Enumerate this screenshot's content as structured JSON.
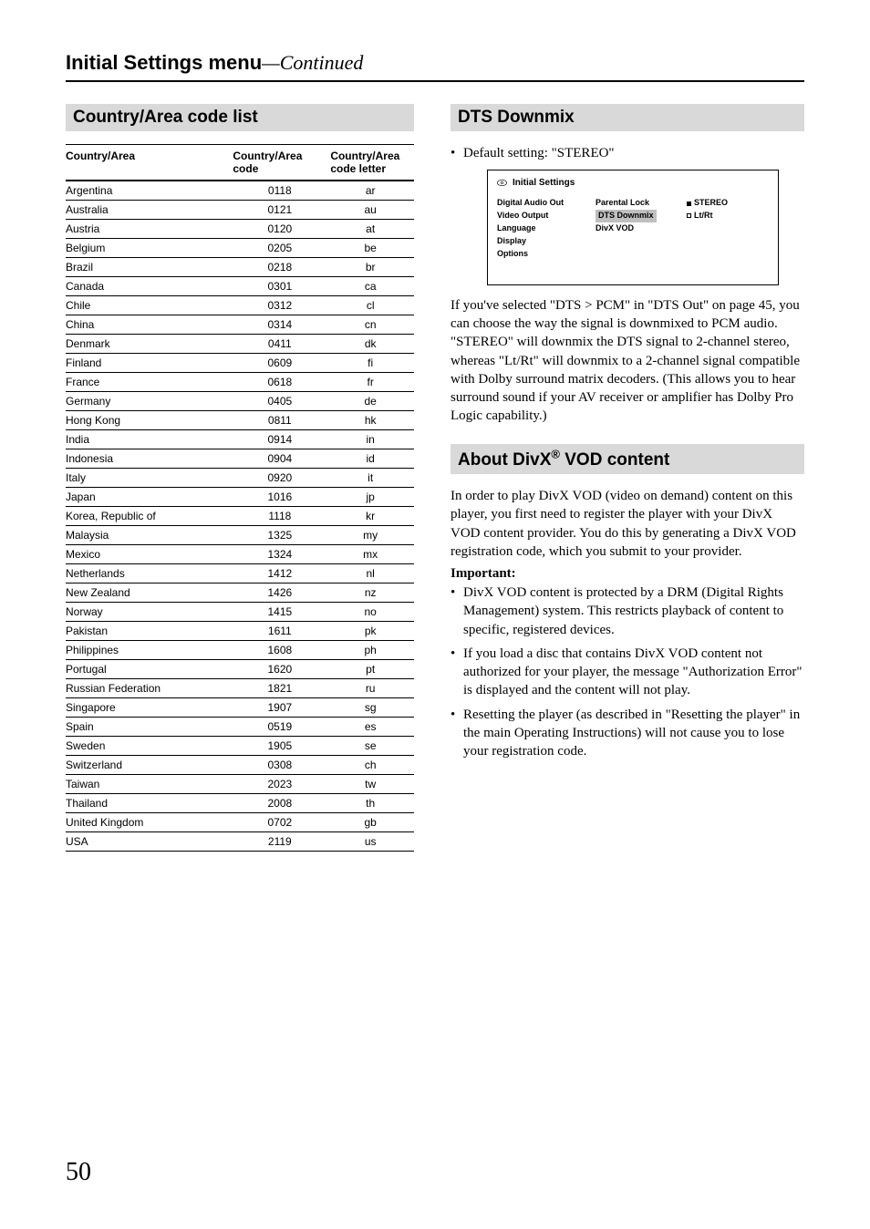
{
  "header": {
    "title": "Initial Settings menu",
    "continued": "—Continued"
  },
  "leftSection": {
    "title": "Country/Area code list",
    "tableHeaders": {
      "col1": "Country/Area",
      "col2": "Country/Area code",
      "col3": "Country/Area code letter"
    },
    "rows": [
      {
        "name": "Argentina",
        "code": "0118",
        "letter": "ar"
      },
      {
        "name": "Australia",
        "code": "0121",
        "letter": "au"
      },
      {
        "name": "Austria",
        "code": "0120",
        "letter": "at"
      },
      {
        "name": "Belgium",
        "code": "0205",
        "letter": "be"
      },
      {
        "name": "Brazil",
        "code": "0218",
        "letter": "br"
      },
      {
        "name": "Canada",
        "code": "0301",
        "letter": "ca"
      },
      {
        "name": "Chile",
        "code": "0312",
        "letter": "cl"
      },
      {
        "name": "China",
        "code": "0314",
        "letter": "cn"
      },
      {
        "name": "Denmark",
        "code": "0411",
        "letter": "dk"
      },
      {
        "name": "Finland",
        "code": "0609",
        "letter": "fi"
      },
      {
        "name": "France",
        "code": "0618",
        "letter": "fr"
      },
      {
        "name": "Germany",
        "code": "0405",
        "letter": "de"
      },
      {
        "name": "Hong Kong",
        "code": "0811",
        "letter": "hk"
      },
      {
        "name": "India",
        "code": "0914",
        "letter": "in"
      },
      {
        "name": "Indonesia",
        "code": "0904",
        "letter": "id"
      },
      {
        "name": "Italy",
        "code": "0920",
        "letter": "it"
      },
      {
        "name": "Japan",
        "code": "1016",
        "letter": "jp"
      },
      {
        "name": "Korea, Republic of",
        "code": "1118",
        "letter": "kr"
      },
      {
        "name": "Malaysia",
        "code": "1325",
        "letter": "my"
      },
      {
        "name": "Mexico",
        "code": "1324",
        "letter": "mx"
      },
      {
        "name": "Netherlands",
        "code": "1412",
        "letter": "nl"
      },
      {
        "name": "New Zealand",
        "code": "1426",
        "letter": "nz"
      },
      {
        "name": "Norway",
        "code": "1415",
        "letter": "no"
      },
      {
        "name": "Pakistan",
        "code": "1611",
        "letter": "pk"
      },
      {
        "name": "Philippines",
        "code": "1608",
        "letter": "ph"
      },
      {
        "name": "Portugal",
        "code": "1620",
        "letter": "pt"
      },
      {
        "name": "Russian Federation",
        "code": "1821",
        "letter": "ru"
      },
      {
        "name": "Singapore",
        "code": "1907",
        "letter": "sg"
      },
      {
        "name": "Spain",
        "code": "0519",
        "letter": "es"
      },
      {
        "name": "Sweden",
        "code": "1905",
        "letter": "se"
      },
      {
        "name": "Switzerland",
        "code": "0308",
        "letter": "ch"
      },
      {
        "name": "Taiwan",
        "code": "2023",
        "letter": "tw"
      },
      {
        "name": "Thailand",
        "code": "2008",
        "letter": "th"
      },
      {
        "name": "United Kingdom",
        "code": "0702",
        "letter": "gb"
      },
      {
        "name": "USA",
        "code": "2119",
        "letter": "us"
      }
    ]
  },
  "dtsSection": {
    "title": "DTS Downmix",
    "defaultLine": "Default setting: \"STEREO\"",
    "panel": {
      "title": "Initial Settings",
      "col1": [
        "Digital Audio Out",
        "Video Output",
        "Language",
        "Display",
        "Options"
      ],
      "col2": [
        "Parental Lock",
        "DTS Downmix",
        "DivX VOD"
      ],
      "col2Highlight": 1,
      "col3": [
        {
          "label": "STEREO",
          "selected": true
        },
        {
          "label": "Lt/Rt",
          "selected": false
        }
      ]
    },
    "body": "If you've selected \"DTS > PCM\" in \"DTS Out\" on page 45, you can choose the way the signal is downmixed to PCM audio. \"STEREO\" will downmix the DTS signal to 2-channel stereo, whereas \"Lt/Rt\" will downmix to a 2-channel signal compatible with Dolby surround matrix decoders. (This allows you to hear surround sound if your AV receiver or amplifier has Dolby Pro Logic capability.)"
  },
  "divxSection": {
    "titlePrefix": "About DivX",
    "titleSuffix": " VOD content",
    "intro": "In order to play DivX VOD (video on demand) content on this player, you first need to register the player with your DivX VOD content provider. You do this by generating a DivX VOD registration code, which you submit to your provider.",
    "importantLabel": "Important:",
    "bullets": [
      "DivX VOD content is protected by a DRM (Digital Rights Management) system. This restricts playback of content to specific, registered devices.",
      "If you load a disc that contains DivX VOD content not authorized for your player, the message \"Authorization Error\" is displayed and the content will not play.",
      "Resetting the player (as described in \"Resetting the player\" in the main Operating Instructions) will not cause you to lose your registration code."
    ]
  },
  "pageNumber": "50"
}
